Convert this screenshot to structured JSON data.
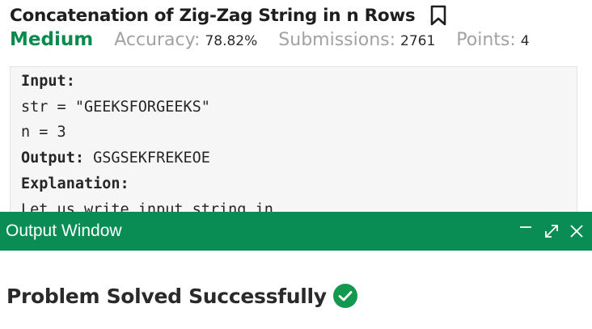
{
  "problem": {
    "title": "Concatenation of Zig-Zag String in n Rows",
    "difficulty": "Medium",
    "accuracy_label": "Accuracy:",
    "accuracy_value": "78.82%",
    "submissions_label": "Submissions:",
    "submissions_value": "2761",
    "points_label": "Points:",
    "points_value": "4"
  },
  "example": {
    "input_label": "Input:",
    "line_str": "str = \"GEEKSFORGEEKS\"",
    "line_n": "n = 3",
    "output_label": "Output:",
    "output_value": "GSGSEKFREKEOE",
    "explanation_label": "Explanation:",
    "explanation_text": "Let us write input string in"
  },
  "output_window": {
    "title": "Output Window",
    "result": "Problem Solved Successfully"
  },
  "colors": {
    "brand_green": "#0a8c55",
    "difficulty_green": "#0b8a4e",
    "check_green": "#12994f"
  },
  "icons": {
    "bookmark": "bookmark-icon",
    "minimize": "minimize-icon",
    "expand": "expand-icon",
    "close": "close-icon",
    "check": "check-circle-icon"
  }
}
